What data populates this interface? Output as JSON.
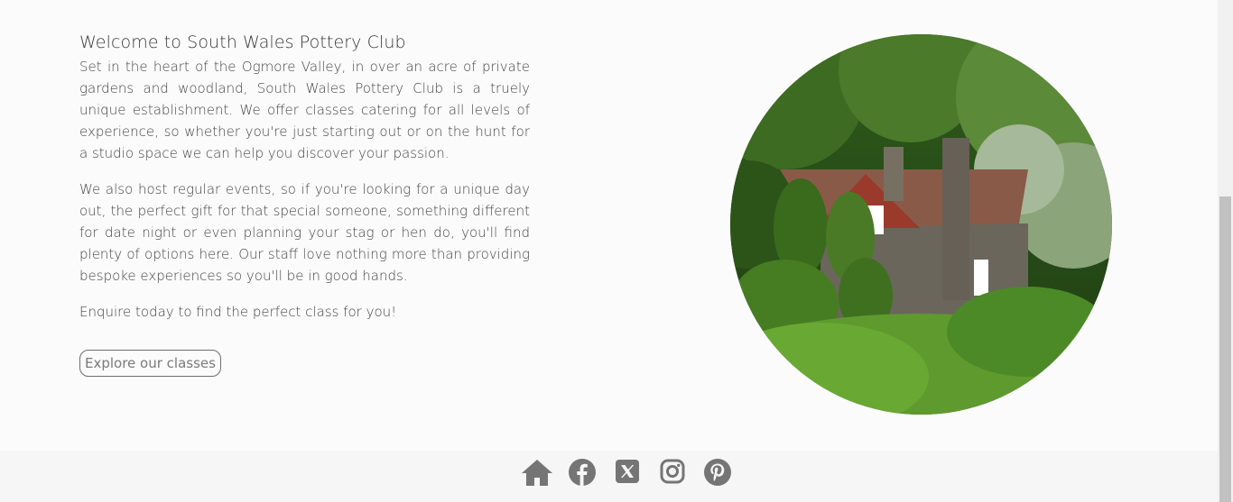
{
  "welcome": {
    "title": "Welcome to South Wales Pottery Club",
    "paragraph1": "Set in the heart of the Ogmore Valley, in over an acre of private gardens and woodland, South Wales Pottery Club is a truely unique establishment. We offer classes catering for all levels of experience, so whether you're just starting out or on the hunt for a studio space we can help you discover your passion.",
    "paragraph2": "We also host regular events, so if you're looking for a unique day out, the perfect gift for that special someone, something different for date night or even planning your stag or hen do, you'll find plenty of options here. Our staff love nothing more than providing bespoke experiences so you'll be in good hands.",
    "paragraph3": "Enquire today to find the perfect class for you!",
    "cta_label": "Explore our classes"
  },
  "footer": {
    "icons": [
      "home-icon",
      "facebook-icon",
      "x-twitter-icon",
      "instagram-icon",
      "pinterest-icon"
    ],
    "icon_color": "#757575"
  },
  "colors": {
    "background": "#fcfbfc",
    "footer_background": "#f6f6f6"
  }
}
